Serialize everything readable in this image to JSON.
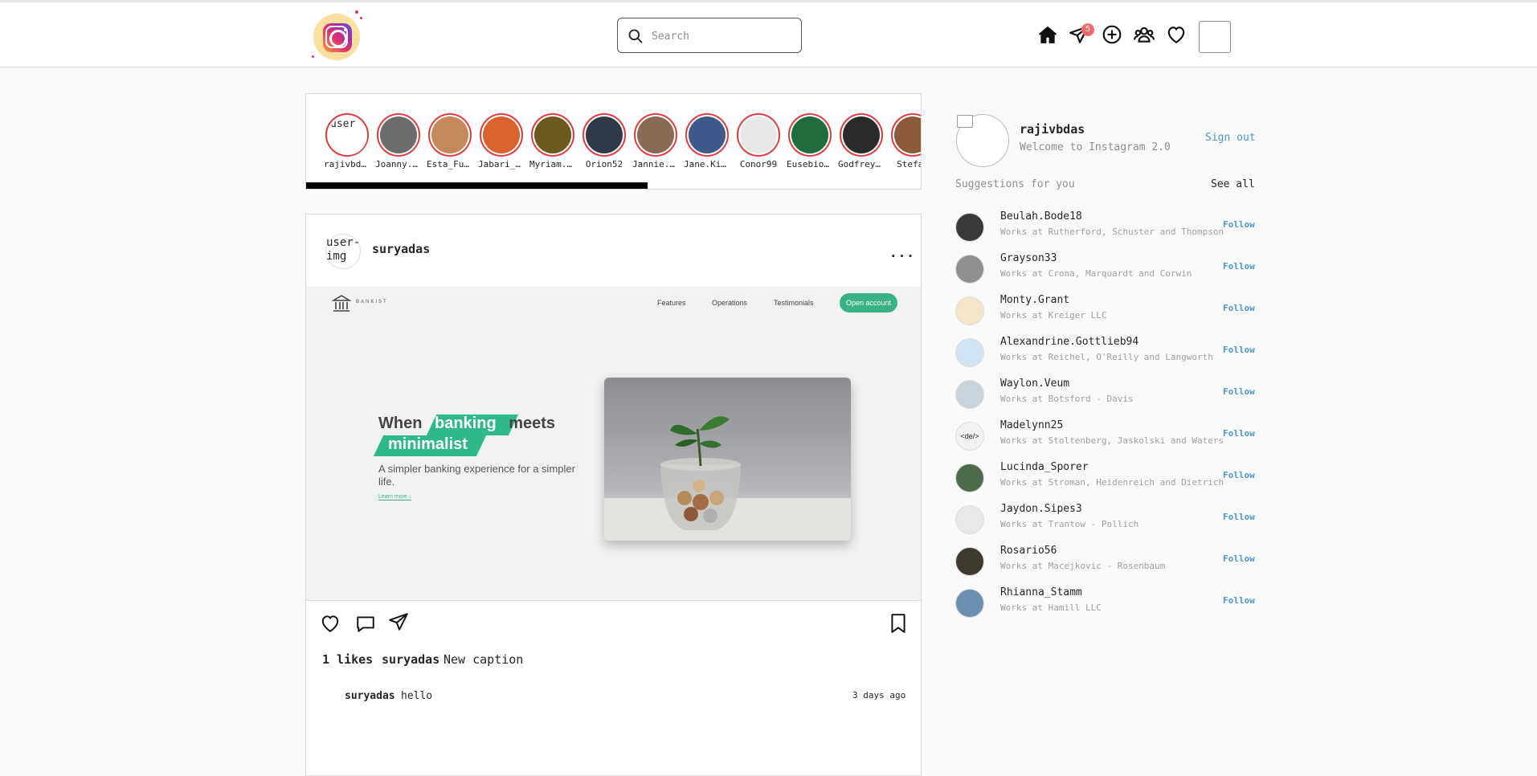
{
  "header": {
    "search_placeholder": "Search",
    "notification_count": "5"
  },
  "stories": [
    {
      "name": "rajivbdas",
      "alt": "user",
      "color": "#ffffff"
    },
    {
      "name": "Joanny.Hintz",
      "color": "#6d6d6d"
    },
    {
      "name": "Esta_Fu...",
      "color": "#c58a5a"
    },
    {
      "name": "Jabari_Jones",
      "color": "#d9642e"
    },
    {
      "name": "Myriam.Stoltenberg",
      "color": "#6b5a1c"
    },
    {
      "name": "Orion52",
      "color": "#2e3b46"
    },
    {
      "name": "Jannie.Ward",
      "color": "#8a6a55"
    },
    {
      "name": "Jane.Kihn",
      "color": "#3d5a8a"
    },
    {
      "name": "Conor99",
      "color": "#e8e8e8"
    },
    {
      "name": "Eusebio.Mills",
      "color": "#1f6d3e"
    },
    {
      "name": "Godfrey.Hills",
      "color": "#2b2b2b"
    },
    {
      "name": "Stefan",
      "color": "#8b5a3b"
    }
  ],
  "post": {
    "username": "suryadas",
    "user_img_alt": "user-img",
    "more": "...",
    "image": {
      "brand": "BANKIST",
      "nav": [
        "Features",
        "Operations",
        "Testimonials"
      ],
      "cta": "Open account",
      "headline_1": "When",
      "headline_hl1": "banking",
      "headline_2": "meets",
      "headline_hl2": "minimalist",
      "subtext": "A simpler banking experience for a simpler life.",
      "learn_more": "Learn more ↓"
    },
    "likes": "1 likes",
    "caption_user": "suryadas",
    "caption": "New caption",
    "comment_user": "suryadas",
    "comment": "hello",
    "comment_time": "3 days ago"
  },
  "sidebar": {
    "username": "rajivbdas",
    "welcome": "Welcome to Instagram 2.0",
    "sign_out": "Sign out",
    "suggestions_title": "Suggestions for you",
    "see_all": "See all",
    "follow_label": "Follow",
    "suggestions": [
      {
        "username": "Beulah.Bode18",
        "work": "Works at Rutherford, Schuster and Thompson",
        "color": "#3a3a3a"
      },
      {
        "username": "Grayson33",
        "work": "Works at Crona, Marquardt and Corwin",
        "color": "#8f8f8f"
      },
      {
        "username": "Monty.Grant",
        "work": "Works at Kreiger LLC",
        "color": "#f3e6c9"
      },
      {
        "username": "Alexandrine.Gottlieb94",
        "work": "Works at Reichel, O'Reilly and Langworth",
        "color": "#cfe3f3"
      },
      {
        "username": "Waylon.Veum",
        "work": "Works at Botsford - Davis",
        "color": "#c9d3dc"
      },
      {
        "username": "Madelynn25",
        "work": "Works at Stoltenberg, Jaskolski and Waters",
        "color": "#f2f2f2",
        "text": "<de/>"
      },
      {
        "username": "Lucinda_Sporer",
        "work": "Works at Stroman, Heidenreich and Dietrich",
        "color": "#4b6b4a"
      },
      {
        "username": "Jaydon.Sipes3",
        "work": "Works at Trantow - Pollich",
        "color": "#e9e9e9"
      },
      {
        "username": "Rosario56",
        "work": "Works at Macejkovic - Rosenbaum",
        "color": "#3f3a2e"
      },
      {
        "username": "Rhianna_Stamm",
        "work": "Works at Hamill LLC",
        "color": "#6a8fb0"
      }
    ]
  }
}
